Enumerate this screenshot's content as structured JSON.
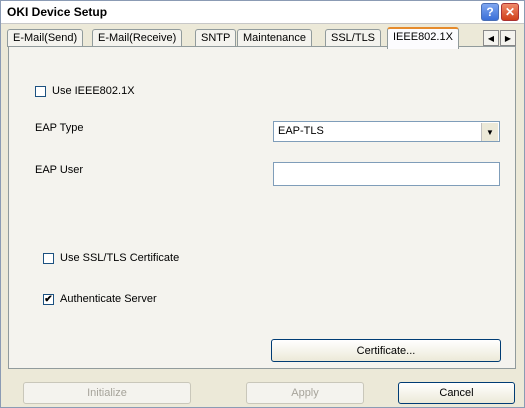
{
  "window": {
    "title": "OKI Device Setup",
    "help_label": "?",
    "close_label": "✕"
  },
  "tabs": [
    {
      "label": "E-Mail(Send)"
    },
    {
      "label": "E-Mail(Receive)"
    },
    {
      "label": "SNTP"
    },
    {
      "label": "Maintenance"
    },
    {
      "label": "SSL/TLS"
    },
    {
      "label": "IEEE802.1X",
      "active": true
    }
  ],
  "tab_scroll": {
    "left": "◀",
    "right": "▶"
  },
  "panel": {
    "use_ieee_label": "Use IEEE802.1X",
    "use_ieee_checked": false,
    "eap_type_label": "EAP Type",
    "eap_type_value": "EAP-TLS",
    "eap_user_label": "EAP User",
    "eap_user_value": "",
    "use_ssl_label": "Use SSL/TLS Certificate",
    "use_ssl_checked": false,
    "auth_server_label": "Authenticate Server",
    "auth_server_checked": true,
    "certificate_button": "Certificate..."
  },
  "footer": {
    "initialize_label": "Initialize",
    "apply_label": "Apply",
    "cancel_label": "Cancel"
  }
}
